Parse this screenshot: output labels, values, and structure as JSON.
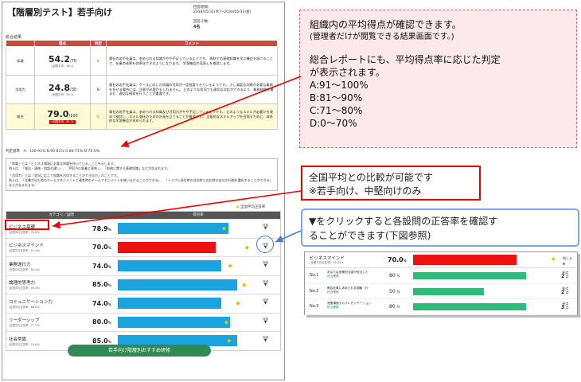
{
  "report": {
    "title": "【階層別テスト】若手向け",
    "period_label": "回答期間：",
    "period": "2018/05/31(木)～2030/05/31(金)",
    "respondents_label": "回答人数：",
    "respondents": "4名",
    "section_label": "総合結果",
    "headers": [
      "",
      "得点",
      "判定",
      "コメント"
    ],
    "rows": [
      {
        "category": "知識",
        "score": "54.2",
        "max": "/70",
        "avg": "(全国平均：56.1)",
        "grade": "C",
        "comment": "貴社の若手社員は、求められる知識がやや不足しているようです。 現状での基礎知識を学ぶ機会を設けることで、仕事の成果を効率化できるようになります。 学習機会の見直しを推奨します。"
      },
      {
        "category": "活用力",
        "score": "24.8",
        "max": "/30",
        "avg": "(全国平均：25.1)",
        "grade": "B",
        "comment": "貴社の若手社員は、ケースに応じた知識の活用が一定程度できているようです。 少し高度な判断が必要な業務を任せる場合には、注意が必要かもしれません。 どのような状況でも適切な対応ができるよう、業務経験を積ませ、適切な指導を行うことが重要です。"
      },
      {
        "category": "総合",
        "score": "79.0",
        "max": "/100",
        "avg": "(全国平均：81.7)",
        "grade": "C",
        "comment": "貴社の若手社員は、求められる知識及び活用力がやや不足しているようです。 どのようなスキルが必要かを改めて検討し、スキル強化のための計画を立てることが重要です。 全般的なスキルアップを目指すために、体系的な学習機会が求められます。"
      }
    ],
    "criteria": "判定基準　A：100-91% B:90-81% C:80-71% D:70-0%",
    "notes": [
      "「知識」とは「ビジネス場面に必要な知識を持っている」ことを示します。",
      "例えば、「報告・連絡・相談の違い」、「PDCAの意義と意味」、「財務に関する基礎知識」などが含まれます。",
      "「活用力」とは「状況に応じて知識を活用することができる力」のことです。",
      "例えば、「文書が出た際のチームマネジメントと通常時のチームマネジメントを使い分けることができる」、「トラブル発生時の対応時と対応時の自分の行動を選択することができる」などが含まれます。"
    ],
    "legend": "全国平均正答率",
    "col_category": "カテゴリ／設問",
    "col_rate": "得点率",
    "categories": [
      {
        "name": "ビジネス基礎",
        "avg": "(全国平均正答率：76.0%)",
        "value": "78.9",
        "bar_pct": 78.9,
        "avg_pct": 76.0,
        "red": false
      },
      {
        "name": "ビジネスマインド",
        "avg": "(全国平均正答率：92.4%)",
        "value": "70.0",
        "bar_pct": 70.0,
        "avg_pct": 92.4,
        "red": true
      },
      {
        "name": "業務遂行力",
        "avg": "(全国平均正答率：80.4%)",
        "value": "74.0",
        "bar_pct": 74.0,
        "avg_pct": 80.4,
        "red": false
      },
      {
        "name": "論理的思考力",
        "avg": "(全国平均正答率：90.4%)",
        "value": "85.0",
        "bar_pct": 85.0,
        "avg_pct": 90.4,
        "red": false
      },
      {
        "name": "コミュニケーション力",
        "avg": "(全国平均正答率：86.0%)",
        "value": "74.0",
        "bar_pct": 74.0,
        "avg_pct": 86.0,
        "red": false
      },
      {
        "name": "リーダーシップ",
        "avg": "(全国平均正答率：77.7%)",
        "value": "80.0",
        "bar_pct": 80.0,
        "avg_pct": 77.7,
        "red": false
      },
      {
        "name": "社会常識",
        "avg": "(全国平均正答率：79.6%)",
        "value": "85.0",
        "bar_pct": 85.0,
        "avg_pct": 79.6,
        "red": false
      }
    ],
    "pct_sign": "%",
    "detail_label": "詳細",
    "recommend_button": "若手向け階層別おすすめ研修"
  },
  "annotations": {
    "pink_lines": [
      "組織内の平均得点が確認できます。",
      "(管理者だけが閲覧できる結果画面です。)",
      "",
      "総合レポートにも、平均得点率に応じた判定",
      "が表示されます。",
      "A:91～100%",
      "B:81～90%",
      "C:71～80%",
      "D:0～70%"
    ],
    "callout1": [
      "全国平均との比較が可能です",
      "※若手向け、中堅向けのみ"
    ],
    "callout2": [
      "▼をクリックすると各設問の正答率を確認す",
      "ることができます(下図参照)"
    ]
  },
  "inset": {
    "name": "ビジネスマインド",
    "avg": "(全国平均正答率：92.4%)",
    "value": "70.0",
    "pct": "%",
    "bar_pct": 70,
    "close": "閉じる",
    "questions": [
      {
        "no": "No.1",
        "text": "あなたは営業担当者が担当した",
        "tag": "担当業務",
        "pct": "80",
        "bar_pct": 80,
        "score": "2",
        "score_label": "配点",
        "unit": "点"
      },
      {
        "no": "No.2",
        "text": "教会社員に求められる規範・行",
        "tag": "担当業務",
        "pct": "50",
        "bar_pct": 50,
        "score": "2",
        "score_label": "配点",
        "unit": "点"
      },
      {
        "no": "No.3",
        "text": "営業場面でのプレゼンテーション",
        "tag": "担当業務",
        "pct": "80",
        "bar_pct": 80,
        "score": "3",
        "score_label": "配点",
        "unit": "点"
      }
    ]
  }
}
